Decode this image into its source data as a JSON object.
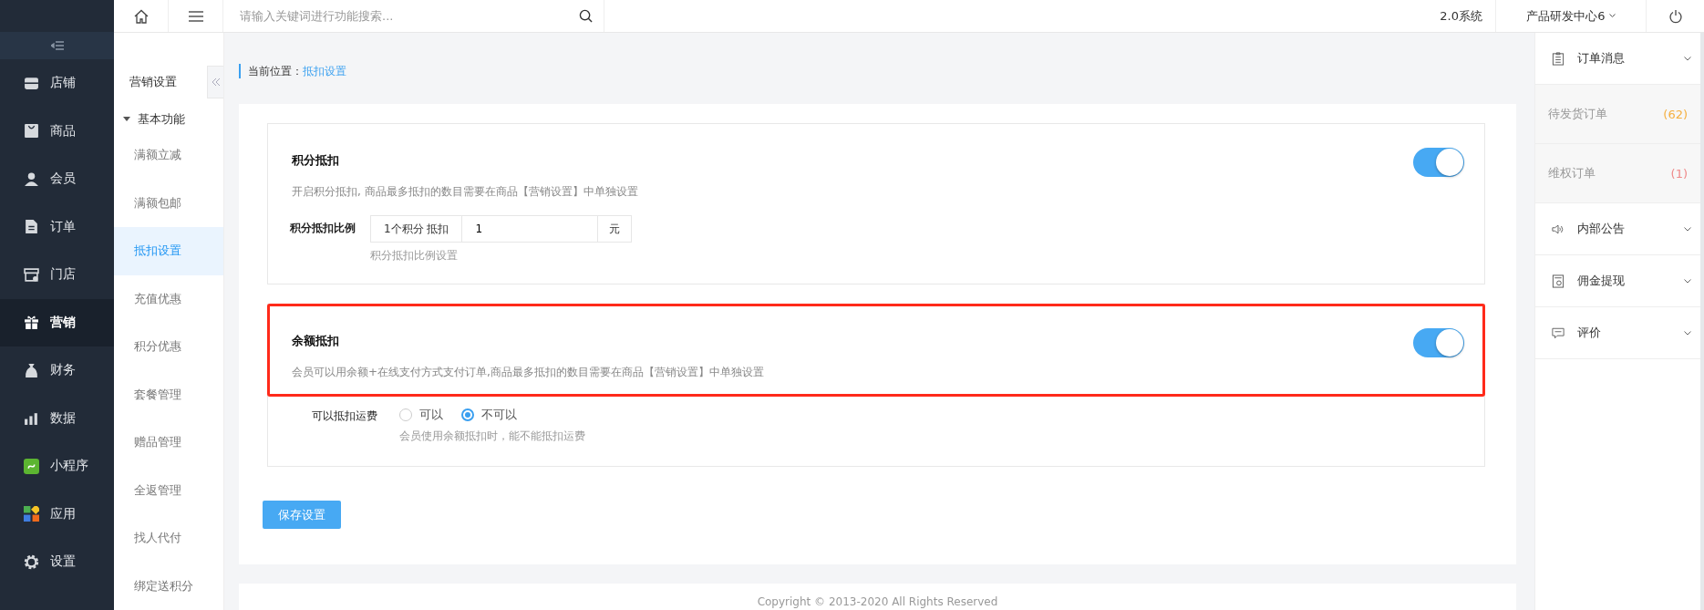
{
  "sidebar": {
    "items": [
      {
        "label": "店铺",
        "selected": false
      },
      {
        "label": "商品",
        "selected": false
      },
      {
        "label": "会员",
        "selected": false
      },
      {
        "label": "订单",
        "selected": false
      },
      {
        "label": "门店",
        "selected": false
      },
      {
        "label": "营销",
        "selected": true
      },
      {
        "label": "财务",
        "selected": false
      },
      {
        "label": "数据",
        "selected": false
      },
      {
        "label": "小程序",
        "selected": false
      },
      {
        "label": "应用",
        "selected": false
      },
      {
        "label": "设置",
        "selected": false
      }
    ]
  },
  "submenu": {
    "title": "营销设置",
    "group": {
      "label": "基本功能",
      "expanded": true
    },
    "items": [
      {
        "label": "满额立减",
        "selected": false
      },
      {
        "label": "满额包邮",
        "selected": false
      },
      {
        "label": "抵扣设置",
        "selected": true
      },
      {
        "label": "充值优惠",
        "selected": false
      },
      {
        "label": "积分优惠",
        "selected": false
      },
      {
        "label": "套餐管理",
        "selected": false
      },
      {
        "label": "赠品管理",
        "selected": false
      },
      {
        "label": "全返管理",
        "selected": false
      },
      {
        "label": "找人代付",
        "selected": false
      },
      {
        "label": "绑定送积分",
        "selected": false
      }
    ]
  },
  "topbar": {
    "search_placeholder": "请输入关键词进行功能搜索...",
    "system": "2.0系统",
    "organization": "产品研发中心6"
  },
  "breadcrumb": {
    "label": "当前位置：",
    "current": "抵扣设置"
  },
  "sections": [
    {
      "kind": "ratio",
      "title": "积分抵扣",
      "description": "开启积分抵扣, 商品最多抵扣的数目需要在商品【营销设置】中单独设置",
      "on": true,
      "highlighted": false,
      "field": {
        "label": "积分抵扣比例",
        "prefix": "1个积分 抵扣",
        "value": "1",
        "suffix": "元",
        "help": "积分抵扣比例设置"
      }
    },
    {
      "kind": "choice",
      "title": "余额抵扣",
      "description": "会员可以用余额+在线支付方式支付订单,商品最多抵扣的数目需要在商品【营销设置】中单独设置",
      "on": true,
      "highlighted": true,
      "option": {
        "label": "可以抵扣运费",
        "choices": [
          {
            "label": "可以",
            "selected": false
          },
          {
            "label": "不可以",
            "selected": true
          }
        ],
        "help": "会员使用余额抵扣时，能不能抵扣运费"
      }
    }
  ],
  "save_button": "保存设置",
  "footer": "Copyright © 2013-2020 All Rights Reserved",
  "right_panel": {
    "items": [
      {
        "kind": "header",
        "label": "订单消息"
      },
      {
        "kind": "count",
        "label": "待发货订单",
        "count": "(62)",
        "color": "#f5b041"
      },
      {
        "kind": "count",
        "label": "维权订单",
        "count": "(1)",
        "color": "#ef8a8a"
      },
      {
        "kind": "header",
        "label": "内部公告"
      },
      {
        "kind": "header",
        "label": "佣金提现"
      },
      {
        "kind": "header",
        "label": "评价"
      }
    ]
  }
}
